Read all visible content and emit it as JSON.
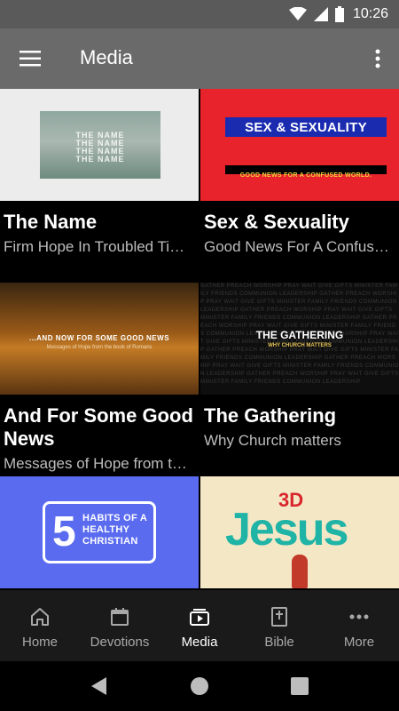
{
  "status": {
    "time": "10:26"
  },
  "appbar": {
    "title": "Media"
  },
  "cards": [
    {
      "title": "The Name",
      "subtitle": "Firm Hope In Troubled Times",
      "thumb": {
        "lines": [
          "THE NAME",
          "THE NAME",
          "THE NAME",
          "THE NAME"
        ]
      }
    },
    {
      "title": "Sex & Sexuality",
      "subtitle": "Good News For A Confused World",
      "thumb": {
        "banner": "SEX & SEXUALITY",
        "tagline": "GOOD NEWS FOR A CONFUSED WORLD."
      }
    },
    {
      "title": "And For Some Good News",
      "subtitle": "Messages of Hope from the Book of Romans",
      "thumb": {
        "headline": "...AND NOW FOR SOME GOOD NEWS",
        "sub": "Messages of Hope from the book of Romans"
      }
    },
    {
      "title": "The Gathering",
      "subtitle": "Why Church matters",
      "thumb": {
        "head": "THE GATHERING",
        "sub": "WHY CHURCH MATTERS",
        "bg": "GATHER PREACH WORSHIP PRAY WAIT GIVE GIFTS MINISTER FAMILY FRIENDS COMMUNION LEADERSHIP GATHER PREACH WORSHIP PRAY WAIT GIVE GIFTS MINISTER FAMILY FRIENDS COMMUNION LEADERSHIP GATHER PREACH WORSHIP PRAY WAIT GIVE GIFTS MINISTER FAMILY FRIENDS COMMUNION LEADERSHIP GATHER PREACH WORSHIP PRAY WAIT GIVE GIFTS MINISTER FAMILY FRIENDS COMMUNION LEADERSHIP GATHER PREACH WORSHIP PRAY WAIT GIVE GIFTS MINISTER FAMILY FRIENDS COMMUNION LEADERSHIP GATHER PREACH WORSHIP PRAY WAIT GIVE GIFTS MINISTER FAMILY FRIENDS COMMUNION LEADERSHIP GATHER PREACH WORSHIP PRAY WAIT GIVE GIFTS MINISTER FAMILY FRIENDS COMMUNION LEADERSHIP GATHER PREACH WORSHIP PRAY WAIT GIVE GIFTS MINISTER FAMILY FRIENDS COMMUNION LEADERSHIP"
      }
    },
    {
      "thumb": {
        "num": "5",
        "text": "HABITS OF A HEALTHY CHRISTIAN"
      }
    },
    {
      "thumb": {
        "prefix": "3D",
        "word": "Jesus"
      }
    }
  ],
  "nav": [
    {
      "label": "Home",
      "icon": "home-icon"
    },
    {
      "label": "Devotions",
      "icon": "calendar-icon"
    },
    {
      "label": "Media",
      "icon": "media-icon",
      "active": true
    },
    {
      "label": "Bible",
      "icon": "bible-icon"
    },
    {
      "label": "More",
      "icon": "more-icon"
    }
  ],
  "colors": {
    "appbar": "#6a6a6a",
    "statusbar": "#5a5a5a",
    "nav_bg": "#1a1a1a",
    "active": "#ffffff",
    "inactive": "#a8a8a8"
  }
}
